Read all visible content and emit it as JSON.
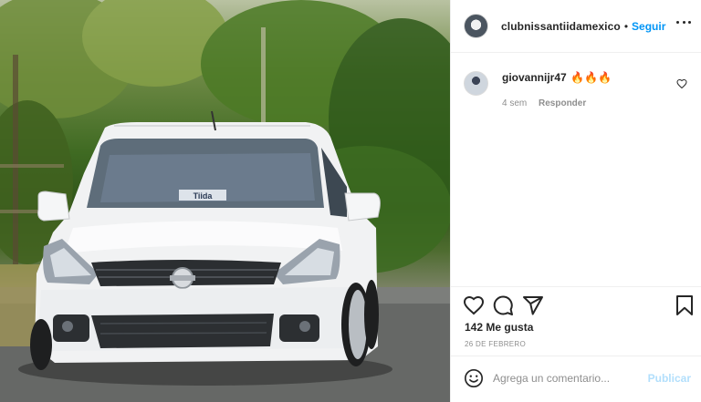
{
  "post": {
    "author": {
      "username": "clubnissantiidamexico",
      "separator": "•",
      "follow_label": "Seguir"
    },
    "comments": [
      {
        "username": "giovannijr47",
        "text": "🔥🔥🔥",
        "age": "4 sem",
        "reply_label": "Responder"
      }
    ],
    "likes_label": "142 Me gusta",
    "date_label": "26 DE FEBRERO",
    "add_comment": {
      "placeholder": "Agrega un comentario...",
      "publish_label": "Publicar"
    },
    "photo_text": {
      "windshield_decal": "Tiida"
    }
  },
  "colors": {
    "accent": "#0095f6",
    "publish_disabled": "#b2dffc",
    "text": "#262626",
    "secondary_text": "#8e8e8e",
    "border": "#efefef",
    "flame": "#f4781f"
  },
  "icons": [
    "more-options-icon",
    "heart-icon",
    "comment-icon",
    "share-icon",
    "save-icon",
    "emoji-icon"
  ]
}
